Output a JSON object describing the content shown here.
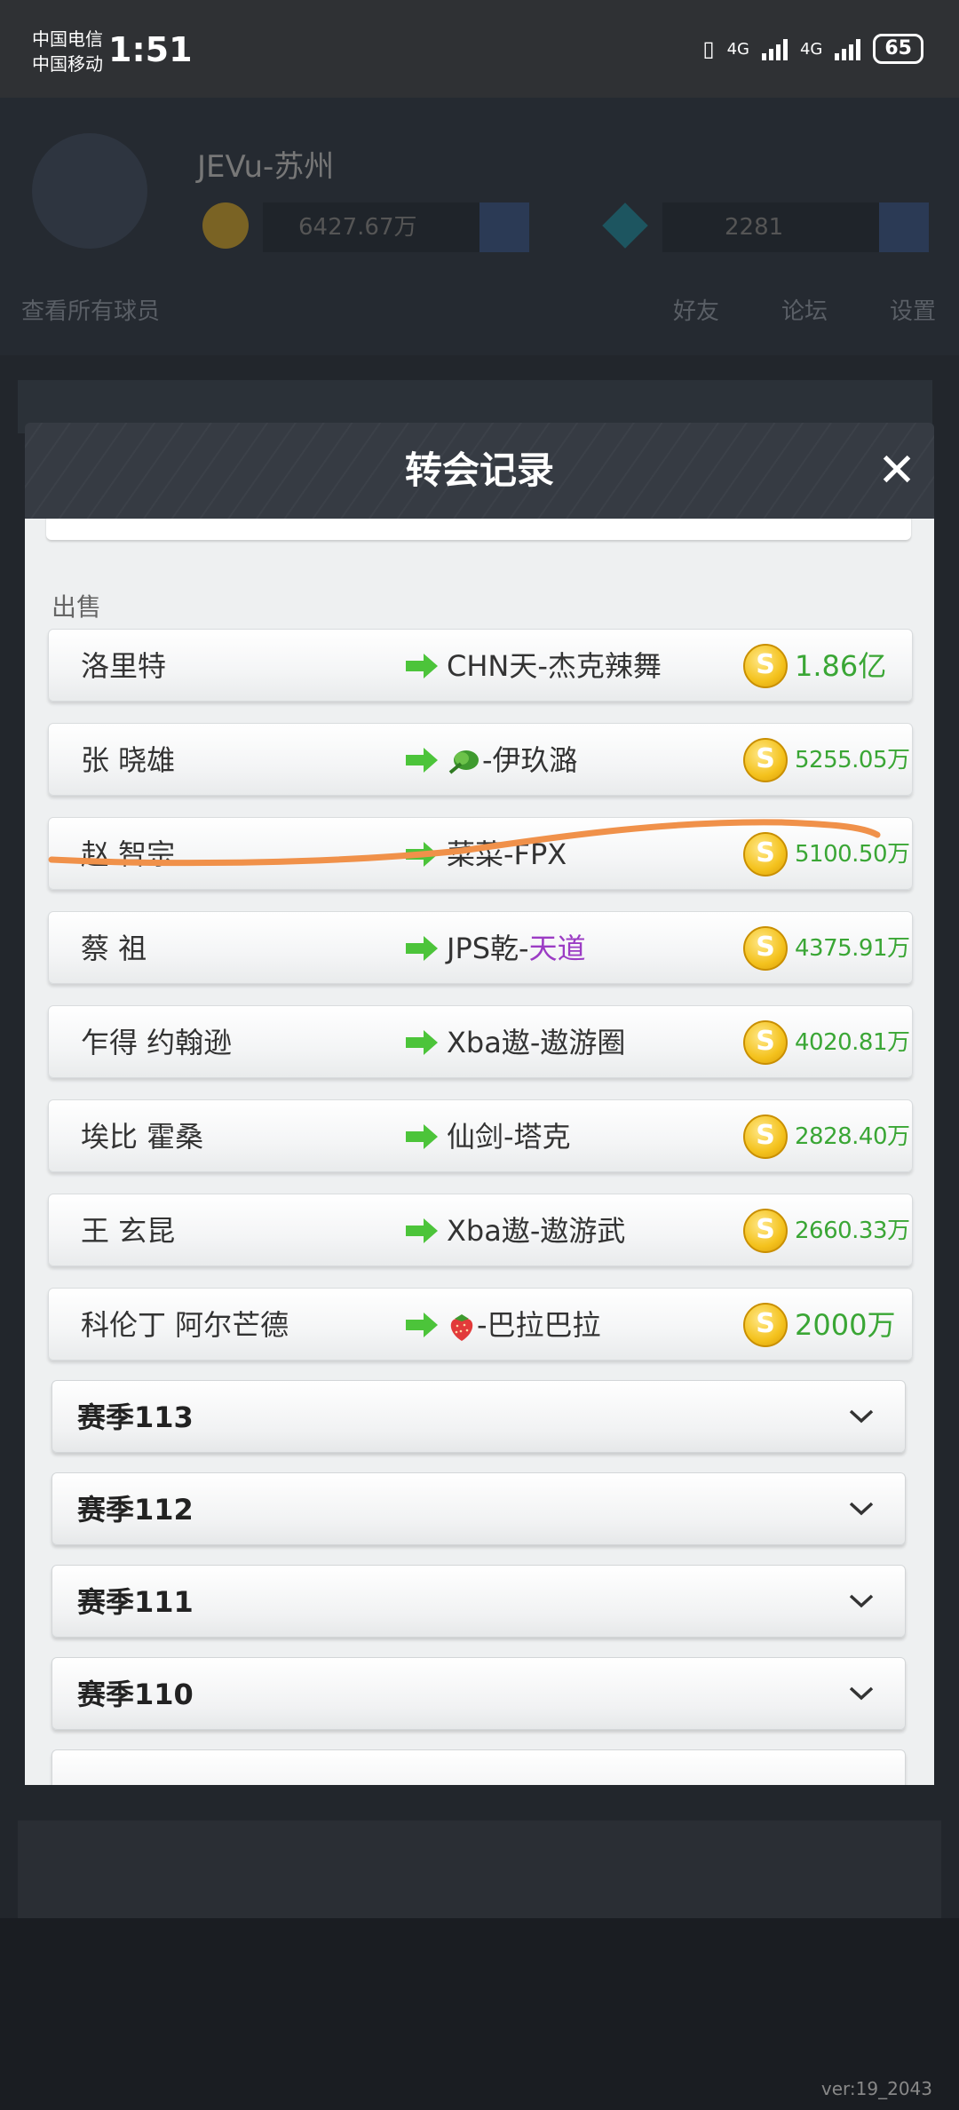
{
  "status_bar": {
    "carrier1": "中国电信",
    "carrier2": "中国移动",
    "time": "1:51",
    "net1": "4G",
    "net2": "4G",
    "battery": "65"
  },
  "background": {
    "username": "JEVu-苏州",
    "coins": "6427.67万",
    "gems": "2281",
    "nav": [
      "查看所有球员",
      "好友",
      "论坛",
      "设置"
    ],
    "version": "ver:19_2043"
  },
  "modal": {
    "title": "转会记录",
    "section_label": "出售",
    "close_glyph": "✕",
    "coin_glyph": "S",
    "transfers": [
      {
        "player": "洛里特",
        "team": "CHN天-杰克辣舞",
        "team_prefix": "",
        "team_accent": "",
        "price": "1.86亿",
        "style": "big"
      },
      {
        "player": "张 晓雄",
        "team": "-伊玖潞",
        "team_prefix": "vegetable",
        "team_accent": "",
        "price": "5255.05万",
        "style": "small"
      },
      {
        "player": "赵 智宗",
        "team": "菜菜-FPX",
        "team_prefix": "",
        "team_accent": "",
        "price": "5100.50万",
        "style": "small"
      },
      {
        "player": "蔡 祖",
        "team": "JPS乾-",
        "team_prefix": "",
        "team_accent": "天道",
        "price": "4375.91万",
        "style": "small"
      },
      {
        "player": "乍得 约翰逊",
        "team": "Xba遨-遨游圈",
        "team_prefix": "",
        "team_accent": "",
        "price": "4020.81万",
        "style": "small"
      },
      {
        "player": "埃比 霍桑",
        "team": "仙剑-塔克",
        "team_prefix": "",
        "team_accent": "",
        "price": "2828.40万",
        "style": "small"
      },
      {
        "player": "王 玄昆",
        "team": "Xba遨-遨游武",
        "team_prefix": "",
        "team_accent": "",
        "price": "2660.33万",
        "style": "small"
      },
      {
        "player": "科伦丁 阿尔芒德",
        "team": "-巴拉巴拉",
        "team_prefix": "strawberry",
        "team_accent": "",
        "price": "2000万",
        "style": "big"
      }
    ],
    "seasons": [
      "赛季113",
      "赛季112",
      "赛季111",
      "赛季110"
    ]
  },
  "colors": {
    "price_green": "#3aa635",
    "arrow_green": "#4cc43a",
    "accent_purple": "#9b3cc4",
    "scribble_orange": "#f0914a"
  }
}
